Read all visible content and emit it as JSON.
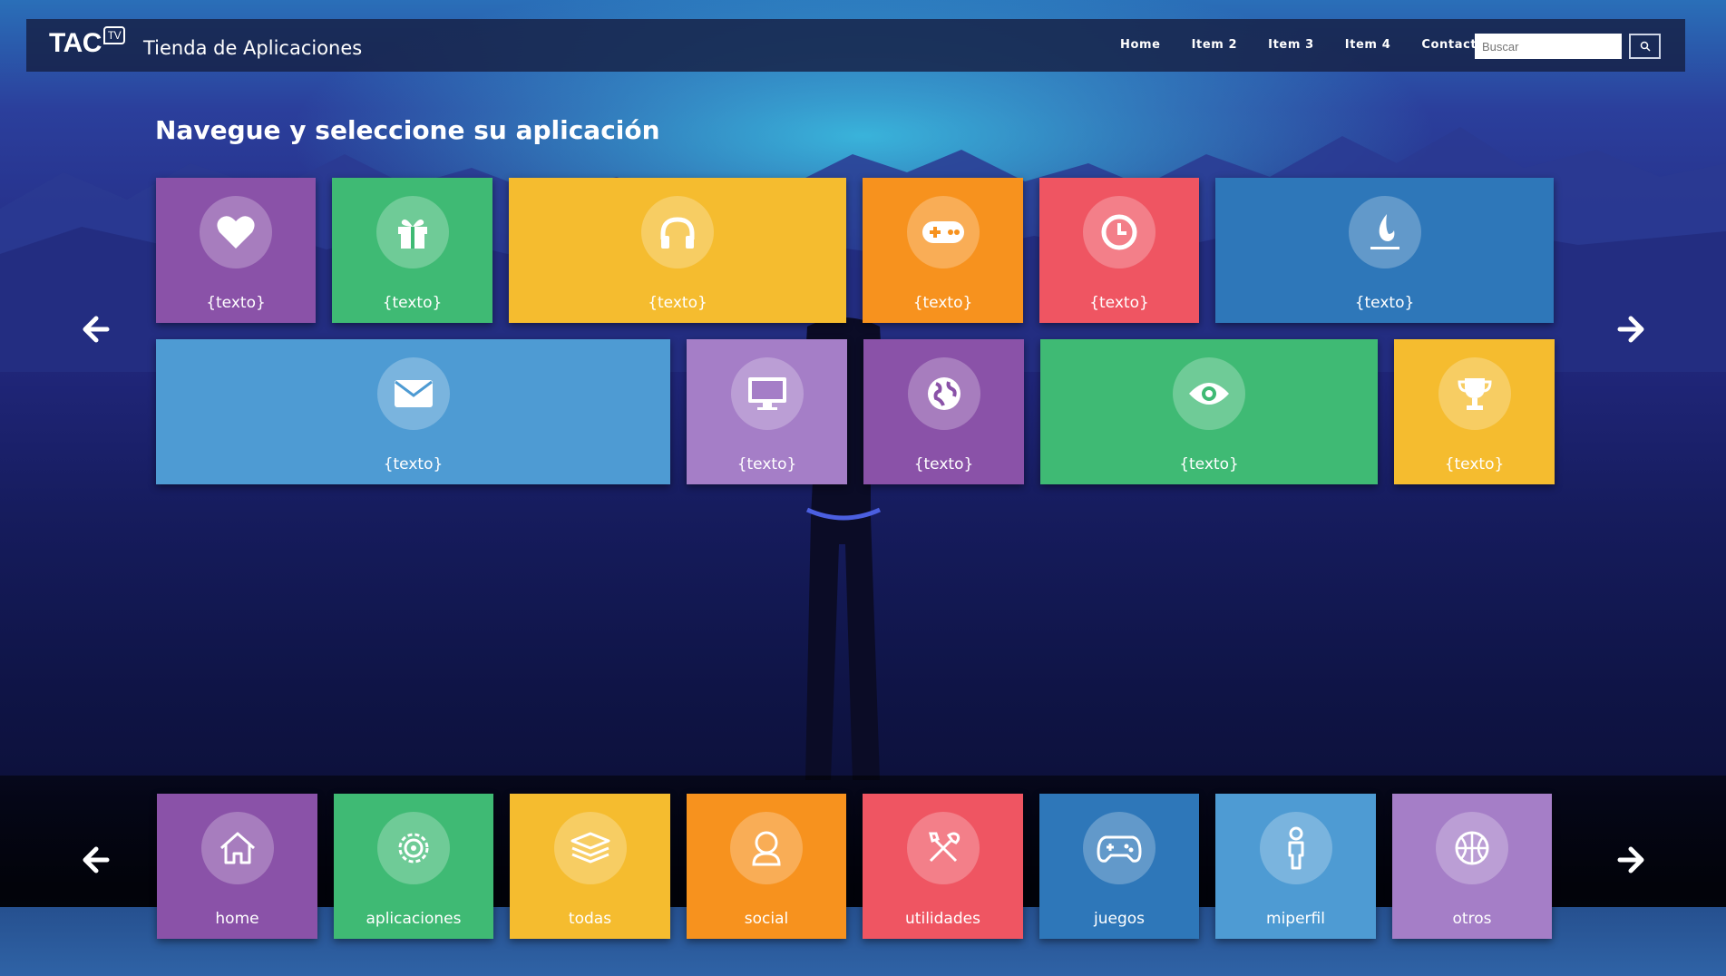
{
  "header": {
    "logo_text": "TAC",
    "logo_badge": "TV",
    "title": "Tienda de Aplicaciones",
    "nav": [
      "Home",
      "Item 2",
      "Item 3",
      "Item 4",
      "Contacto"
    ],
    "search_placeholder": "Buscar"
  },
  "main": {
    "heading": "Navegue y seleccione su aplicación",
    "tiles_row1": [
      {
        "label": "{texto}",
        "icon": "heart-icon",
        "color": "#8a52a8"
      },
      {
        "label": "{texto}",
        "icon": "gift-icon",
        "color": "#3fba74"
      },
      {
        "label": "{texto}",
        "icon": "headphones-icon",
        "color": "#f5bc2f"
      },
      {
        "label": "{texto}",
        "icon": "gamepad-icon",
        "color": "#f7921e"
      },
      {
        "label": "{texto}",
        "icon": "clock-icon",
        "color": "#ef5562"
      },
      {
        "label": "{texto}",
        "icon": "fire-icon",
        "color": "#2e77b9"
      }
    ],
    "tiles_row2": [
      {
        "label": "{texto}",
        "icon": "envelope-icon",
        "color": "#4e9bd3"
      },
      {
        "label": "{texto}",
        "icon": "monitor-icon",
        "color": "#a57ec7"
      },
      {
        "label": "{texto}",
        "icon": "globe-icon",
        "color": "#8a52a8"
      },
      {
        "label": "{texto}",
        "icon": "eye-icon",
        "color": "#3fba74"
      },
      {
        "label": "{texto}",
        "icon": "trophy-icon",
        "color": "#f5bc2f"
      }
    ]
  },
  "dock": {
    "items": [
      {
        "label": "home",
        "icon": "house-icon",
        "color": "#8a52a8"
      },
      {
        "label": "aplicaciones",
        "icon": "settings-icon",
        "color": "#3fba74"
      },
      {
        "label": "todas",
        "icon": "layers-icon",
        "color": "#f5bc2f"
      },
      {
        "label": "social",
        "icon": "user-icon",
        "color": "#f7921e"
      },
      {
        "label": "utilidades",
        "icon": "tools-icon",
        "color": "#ef5562"
      },
      {
        "label": "juegos",
        "icon": "gamepad-icon",
        "color": "#2e77b9"
      },
      {
        "label": "miperfil",
        "icon": "person-icon",
        "color": "#4e9bd3"
      },
      {
        "label": "otros",
        "icon": "basketball-icon",
        "color": "#a57ec7"
      }
    ]
  }
}
